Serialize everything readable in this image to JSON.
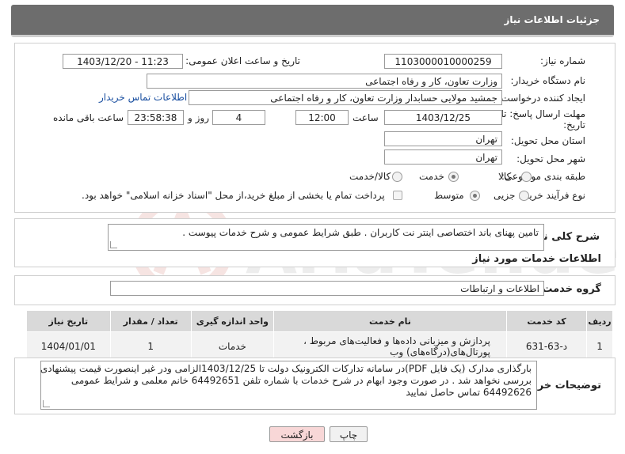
{
  "header": {
    "title": "جزئیات اطلاعات نیاز"
  },
  "fields": {
    "need_number_label": "شماره نیاز:",
    "need_number": "1103000010000259",
    "announce_label": "تاریخ و ساعت اعلان عمومی:",
    "announce_value": "1403/12/20 - 11:23",
    "buyer_org_label": "نام دستگاه خریدار:",
    "buyer_org": "وزارت تعاون، کار و رفاه اجتماعی",
    "creator_label": "ایجاد کننده درخواست:",
    "creator": "جمشید مولایی حسابدار وزارت تعاون، کار و رفاه اجتماعی",
    "contact_link": "اطلاعات تماس خریدار",
    "deadline_label_1": "مهلت ارسال پاسخ: تا",
    "deadline_label_2": "تاریخ:",
    "deadline_date": "1403/12/25",
    "time_label": "ساعت",
    "deadline_time": "12:00",
    "days_value": "4",
    "days_label": "روز و",
    "remaining_time": "23:58:38",
    "remaining_label": "ساعت باقی مانده",
    "province_label": "استان محل تحویل:",
    "province": "تهران",
    "city_label": "شهر محل تحویل:",
    "city": "تهران",
    "category_label": "طبقه بندی موضوعی:",
    "category_options": [
      "کالا",
      "خدمت",
      "کالا/خدمت"
    ],
    "purchase_type_label": "نوع فرآیند خرید :",
    "purchase_options": [
      "جزیی",
      "متوسط"
    ],
    "payment_note": "پرداخت تمام یا بخشی از مبلغ خرید،از محل \"اسناد خزانه اسلامی\" خواهد بود."
  },
  "description": {
    "label": "شرح کلی نیاز:",
    "text": "تامین پهنای باند اختصاصی اینتر نت کاربران . طبق شرایط عمومی و شرح خدمات پیوست ."
  },
  "services": {
    "section_title": "اطلاعات خدمات مورد نیاز",
    "group_label": "گروه خدمت:",
    "group_value": "اطلاعات و ارتباطات",
    "table_headers": [
      "ردیف",
      "کد خدمت",
      "نام خدمت",
      "واحد اندازه گیری",
      "تعداد / مقدار",
      "تاریخ نیاز"
    ],
    "rows": [
      {
        "row": "1",
        "code": "د-63-631",
        "name_line1": "پردازش و میزبانی داده‌ها و فعالیت‌های مربوط ،",
        "name_line2": "پورتال‌های(درگاه‌های) وب",
        "unit": "خدمات",
        "qty": "1",
        "date": "1404/01/01"
      }
    ]
  },
  "buyer_notes": {
    "label": "توضیحات خریدار:",
    "line1": "بارگذاری مدارک (یک فایل PDF)در سامانه تدارکات الکترونیک دولت تا 1403/12/25الزامی ودر غیر اینصورت قیمت پیشنهادی",
    "line2": "بررسی نخواهد شد . در صورت وجود ابهام در شرح خدمات با شماره تلفن 64492651 خانم معلمی و شرایط عمومی",
    "line3": "64492626 تماس حاصل نمایید"
  },
  "buttons": {
    "print": "چاپ",
    "back": "بازگشت"
  },
  "watermark_text": "AriaTender.net",
  "colors": {
    "header_bg": "#6d6d6d",
    "link": "#1a4fa0",
    "table_header": "#d9d9d9",
    "back_btn": "#f8d7d7"
  }
}
